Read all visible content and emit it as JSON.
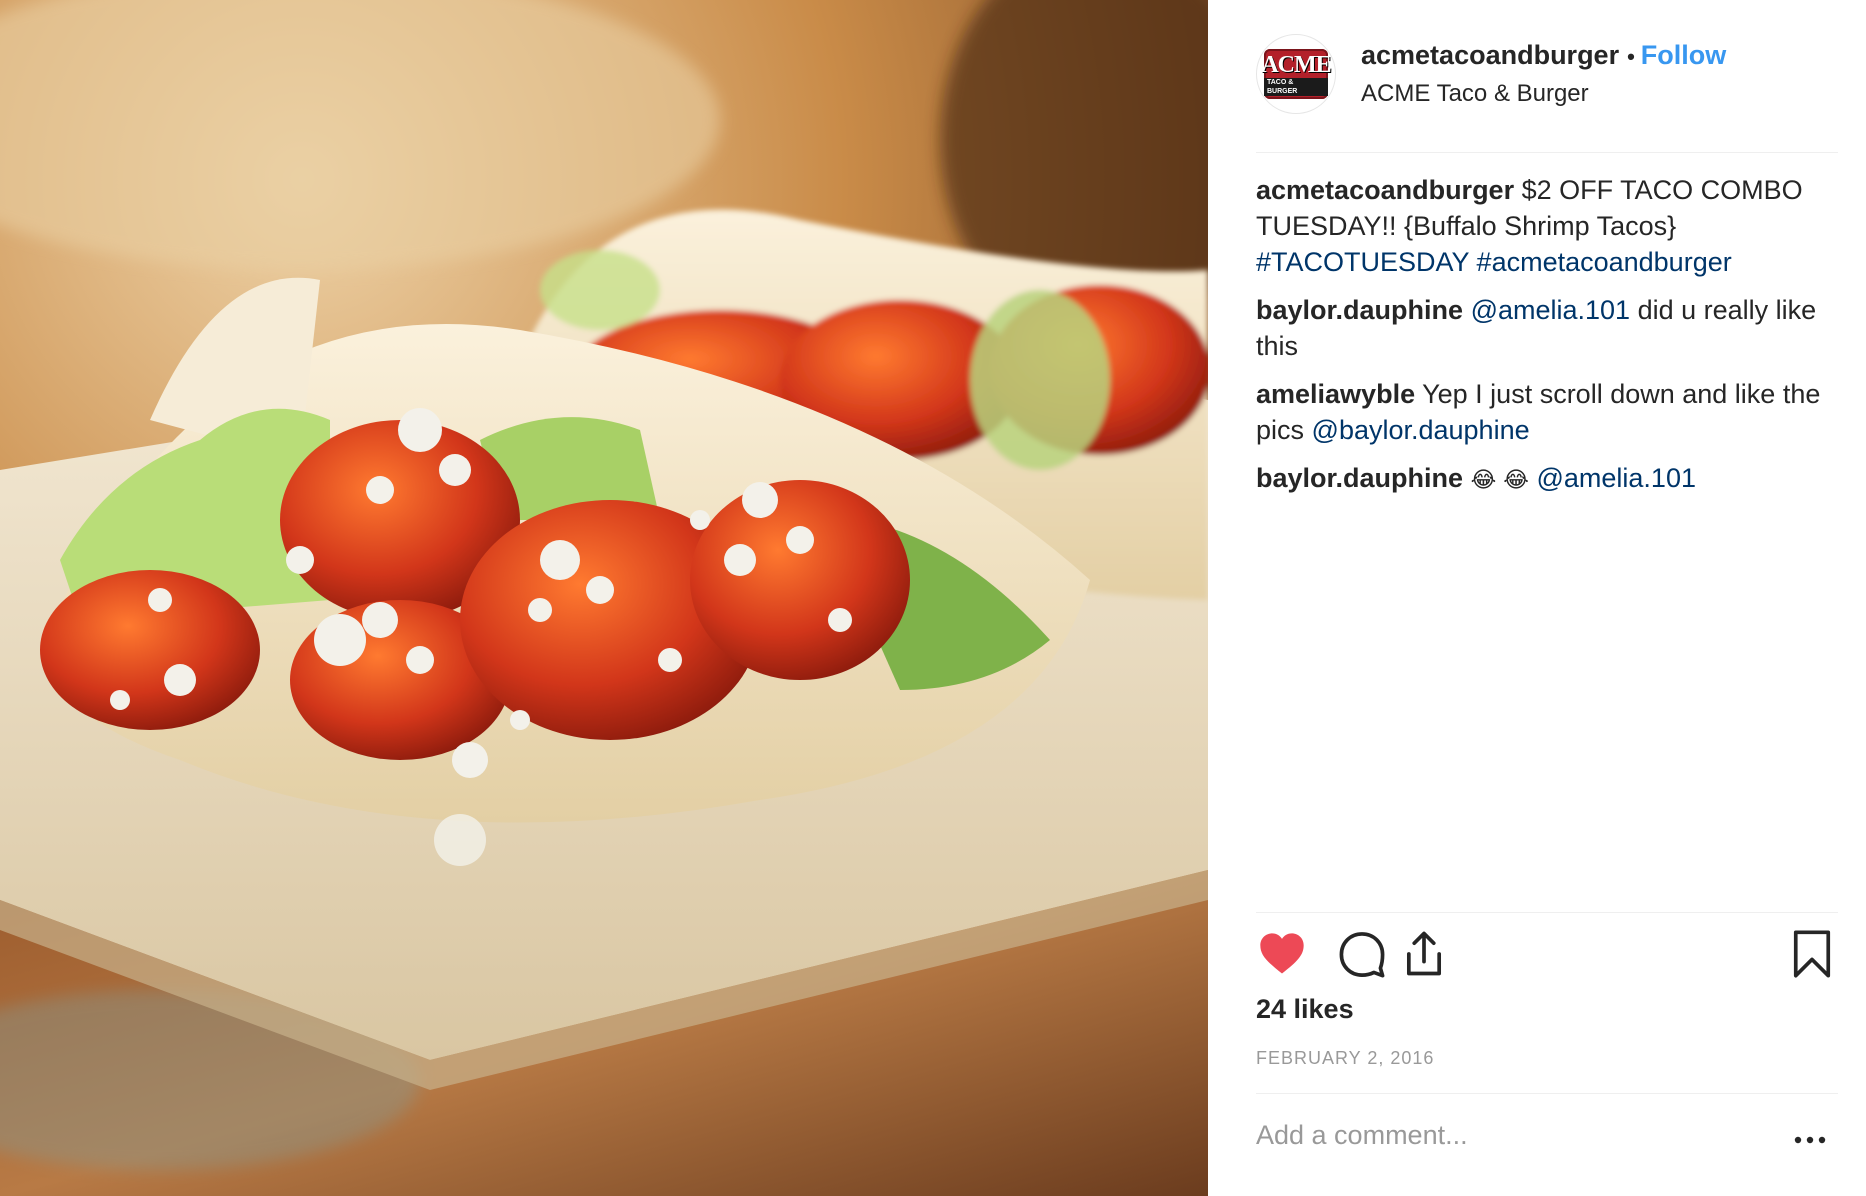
{
  "photo": {
    "alt": ""
  },
  "header": {
    "avatar_logo_top": "ACME",
    "avatar_logo_bottom": "TACO & BURGER",
    "username": "acmetacoandburger",
    "dot": "•",
    "follow_label": "Follow",
    "subtitle": "ACME Taco & Burger"
  },
  "comments": [
    {
      "user": "acmetacoandburger",
      "text": "$2 OFF TACO COMBO TUESDAY!! {Buffalo Shrimp Tacos}",
      "tags": "#TACOTUESDAY #acmetacoandburger"
    },
    {
      "user": "baylor.dauphine",
      "mention": "@amelia.101",
      "text": "did u really like this"
    },
    {
      "user": "ameliawyble",
      "text": "Yep I just scroll down and like the pics",
      "mention": "@baylor.dauphine"
    },
    {
      "user": "baylor.dauphine",
      "emoji": "😂 😂",
      "mention": "@amelia.101"
    }
  ],
  "actions": {
    "like_icon": "heart-icon",
    "comment_icon": "comment-bubble-icon",
    "share_icon": "share-icon",
    "save_icon": "bookmark-icon",
    "liked": true,
    "like_color": "#ed4956"
  },
  "likes_text": "24 likes",
  "date_text": "FEBRUARY 2, 2016",
  "add_comment_placeholder": "Add a comment...",
  "more_icon": "more-horizontal-icon",
  "colors": {
    "link": "#003569",
    "follow": "#3897f0",
    "muted": "#999999"
  }
}
